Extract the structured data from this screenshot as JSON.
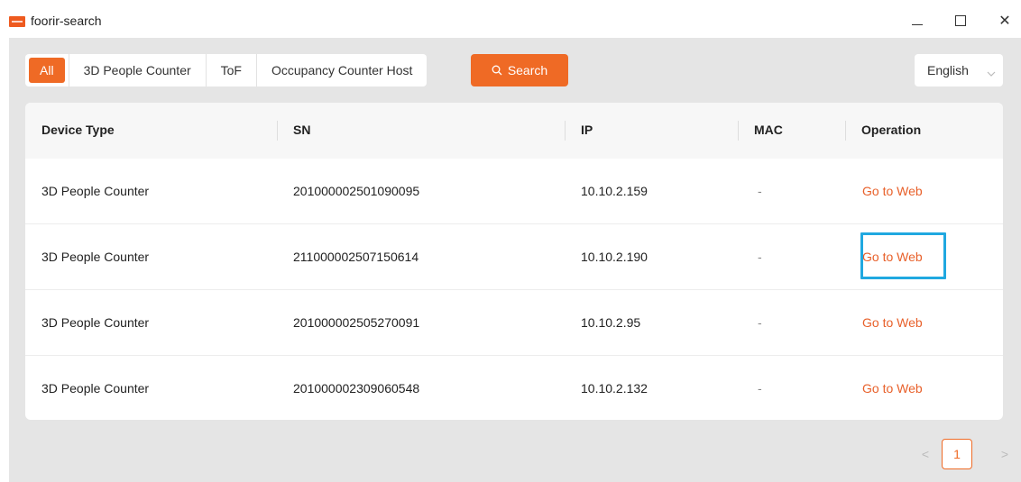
{
  "window": {
    "title": "foorir-search",
    "controls": {
      "minimize_icon": "minimize-icon",
      "maximize_icon": "maximize-icon",
      "close_icon": "close-icon",
      "close_glyph": "✕"
    }
  },
  "filters": [
    {
      "label": "All",
      "active": true
    },
    {
      "label": "3D People Counter",
      "active": false
    },
    {
      "label": "ToF",
      "active": false
    },
    {
      "label": "Occupancy Counter Host",
      "active": false
    }
  ],
  "search_button": {
    "label": "Search",
    "icon": "search-icon"
  },
  "language": {
    "value": "English",
    "icon": "chevron-down-icon"
  },
  "table": {
    "columns": [
      "Device Type",
      "SN",
      "IP",
      "MAC",
      "Operation"
    ],
    "rows": [
      {
        "type": "3D People Counter",
        "sn": "201000002501090095",
        "ip": "10.10.2.159",
        "mac": "-",
        "op": "Go to Web"
      },
      {
        "type": "3D People Counter",
        "sn": "211000002507150614",
        "ip": "10.10.2.190",
        "mac": "-",
        "op": "Go to Web"
      },
      {
        "type": "3D People Counter",
        "sn": "201000002505270091",
        "ip": "10.10.2.95",
        "mac": "-",
        "op": "Go to Web"
      },
      {
        "type": "3D People Counter",
        "sn": "201000002309060548",
        "ip": "10.10.2.132",
        "mac": "-",
        "op": "Go to Web"
      }
    ]
  },
  "pagination": {
    "prev_glyph": "<",
    "current": "1",
    "next_glyph": ">"
  },
  "colors": {
    "accent": "#ef6a25",
    "link": "#e8602a",
    "focus": "#20a8e0",
    "workspace_bg": "#e5e5e5"
  }
}
